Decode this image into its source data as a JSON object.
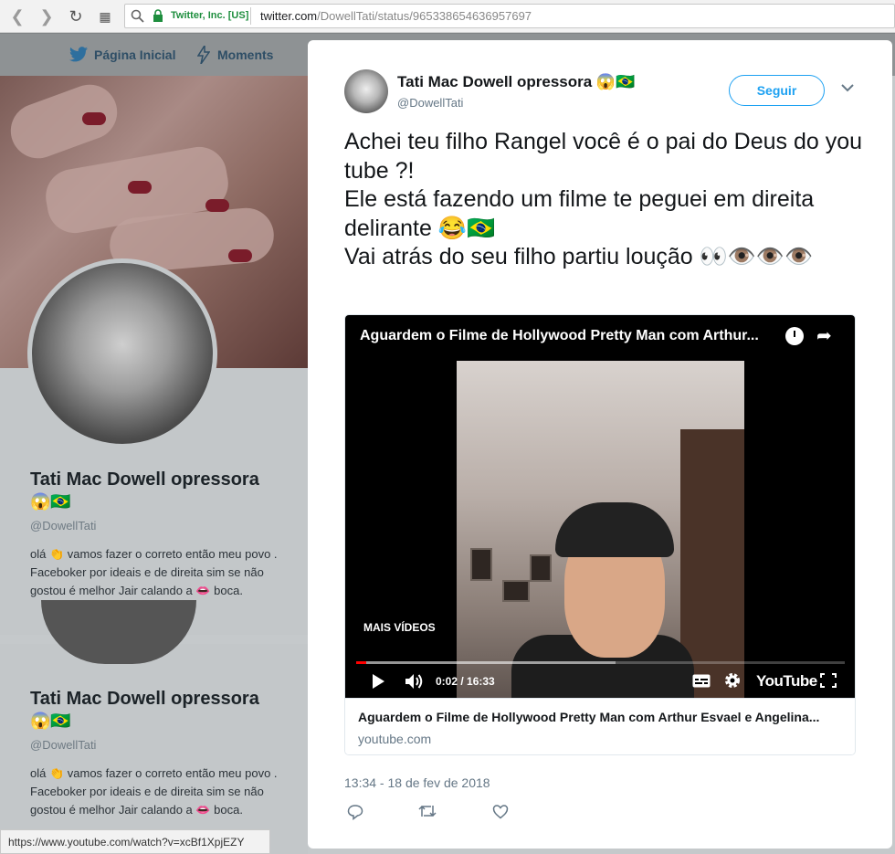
{
  "browser": {
    "secure_label": "Twitter, Inc. [US]",
    "url_host": "twitter.com",
    "url_path": "/DowellTati/status/965338654636957697",
    "status_url": "https://www.youtube.com/watch?v=xcBf1XpjEZY"
  },
  "topbar": {
    "home_label": "Página Inicial",
    "moments_label": "Moments"
  },
  "profile": {
    "name": "Tati Mac Dowell opressora",
    "emoji": "😱🇧🇷",
    "handle": "@DowellTati",
    "bio": "olá 👏 vamos fazer o correto então meu povo . Faceboker por ideais e de direita sim se não gostou é melhor Jair calando a 👄 boca."
  },
  "tweet": {
    "name": "Tati Mac Dowell opressora 😱🇧🇷",
    "handle": "@DowellTati",
    "follow_label": "Seguir",
    "caret": "⌄",
    "text_line1": "Achei teu filho Rangel você é o pai do Deus do you tube ?!",
    "text_line2": "Ele está fazendo um filme te peguei em direita delirante 😂🇧🇷",
    "text_line3": "Vai atrás do seu filho partiu loução 👀👁️👁️👁️",
    "date": "13:34 - 18 de fev de 2018"
  },
  "video": {
    "title": "Aguardem o Filme de Hollywood Pretty Man com Arthur...",
    "more_videos": "MAIS VÍDEOS",
    "time": "0:02 / 16:33",
    "played_fraction": 0.02,
    "buffered_fraction": 0.53,
    "logo": "YouTube",
    "card_title": "Aguardem o Filme de Hollywood Pretty Man com Arthur Esvael e Angelina...",
    "card_domain": "youtube.com"
  },
  "icons": {
    "back": "back-arrow-icon",
    "forward": "forward-arrow-icon",
    "reload": "reload-icon",
    "apps": "apps-grid-icon",
    "search": "search-icon",
    "lock": "lock-icon",
    "bird": "twitter-bird-icon",
    "lightning": "lightning-icon",
    "clock": "watch-later-icon",
    "share": "share-icon",
    "play": "play-icon",
    "volume": "volume-icon",
    "captions": "captions-icon",
    "settings": "settings-gear-icon",
    "fullscreen": "fullscreen-icon",
    "reply": "reply-icon",
    "retweet": "retweet-icon",
    "like": "heart-icon"
  },
  "colors": {
    "twitter_blue": "#1da1f2",
    "secure_green": "#1e8e3e",
    "progress_red": "#ff0000"
  }
}
